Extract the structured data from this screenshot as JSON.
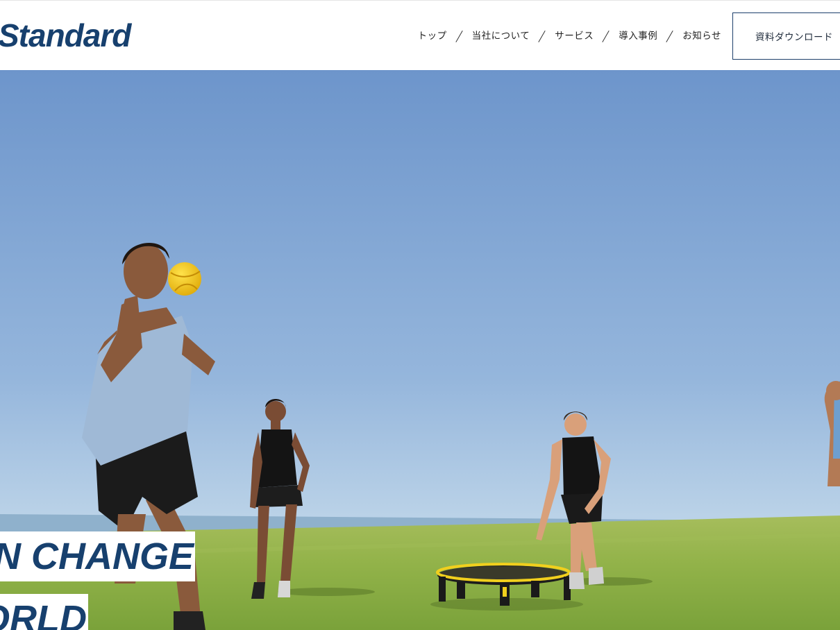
{
  "header": {
    "logo_text": "Standard",
    "nav": [
      {
        "label": "トップ"
      },
      {
        "label": "当社について"
      },
      {
        "label": "サービス"
      },
      {
        "label": "導入事例"
      },
      {
        "label": "お知らせ"
      }
    ],
    "download_button": "資料ダウンロード"
  },
  "hero": {
    "image_icon": "outdoor-roundnet-photo",
    "catch_line_1": "CAN CHANGE",
    "catch_line_2": "WORLD"
  },
  "colors": {
    "brand_navy": "#17406e",
    "sky_top": "#6c95cc",
    "sky_bottom": "#b9d3ea",
    "grass": "#8fb24a",
    "ball": "#f5c518"
  }
}
